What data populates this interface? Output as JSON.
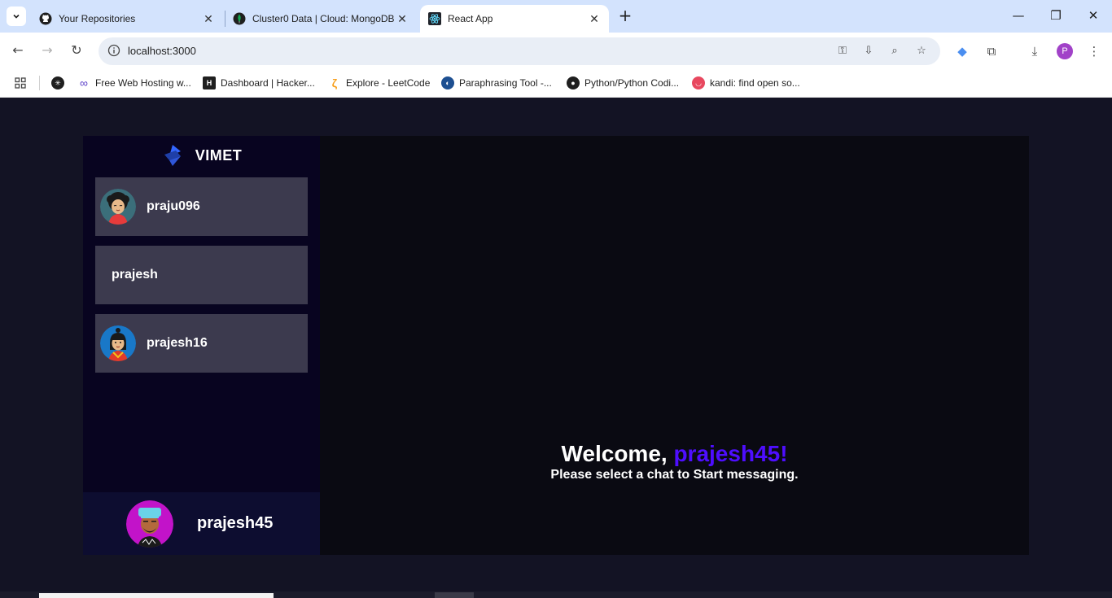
{
  "browser": {
    "tabs": [
      {
        "title": "Your Repositories",
        "icon": "github-icon"
      },
      {
        "title": "Cluster0 Data | Cloud: MongoDB",
        "icon": "mongodb-icon"
      },
      {
        "title": "React App",
        "icon": "react-icon",
        "active": true
      }
    ],
    "url": "localhost:3000",
    "profile_initial": "P",
    "bookmarks": [
      {
        "label": "Free Web Hosting w...",
        "icon": "infinity-icon"
      },
      {
        "label": "Dashboard | Hacker...",
        "icon": "hackerrank-icon"
      },
      {
        "label": "Explore - LeetCode",
        "icon": "leetcode-icon"
      },
      {
        "label": "Paraphrasing Tool -...",
        "icon": "quillbot-icon"
      },
      {
        "label": "Python/Python Codi...",
        "icon": "github-icon"
      },
      {
        "label": "kandi: find open so...",
        "icon": "kandi-icon"
      }
    ]
  },
  "app": {
    "brand": "VIMET",
    "accent_color": "#4e0eff",
    "contacts": [
      {
        "username": "praju096",
        "has_avatar": true
      },
      {
        "username": "prajesh",
        "has_avatar": false
      },
      {
        "username": "prajesh16",
        "has_avatar": true
      }
    ],
    "current_user": "prajesh45",
    "welcome": {
      "greeting": "Welcome, ",
      "username": "prajesh45!",
      "subtitle": "Please select a chat to Start messaging."
    }
  }
}
